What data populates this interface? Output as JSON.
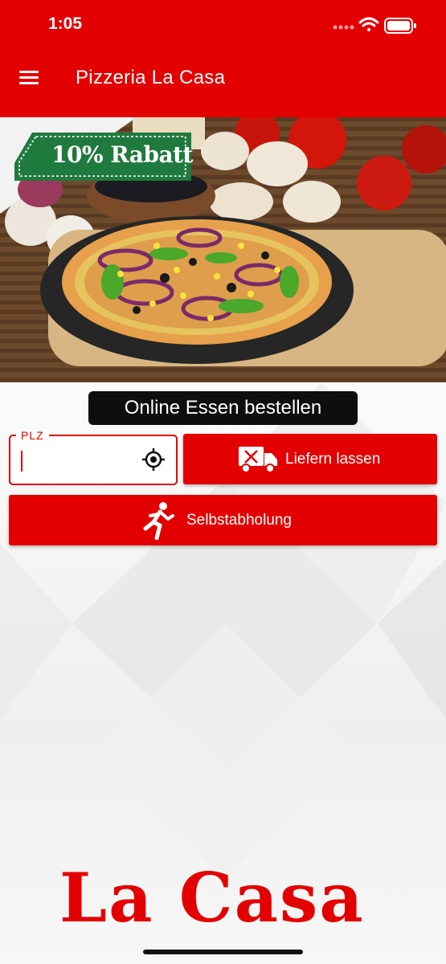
{
  "status_bar": {
    "time": "1:05"
  },
  "app_bar": {
    "title": "Pizzeria La Casa",
    "menu_icon": "hamburger-menu-icon",
    "accent_color": "#e30000"
  },
  "hero": {
    "badge_text": "10% Rabatt",
    "badge_color": "#1f7a3e"
  },
  "order": {
    "heading": "Online Essen bestellen",
    "plz_label": "PLZ",
    "plz_value": "",
    "locate_icon": "crosshair-locate-icon",
    "deliver_label": "Liefern lassen",
    "deliver_icon": "delivery-truck-icon",
    "pickup_label": "Selbstabholung",
    "pickup_icon": "running-person-icon"
  },
  "footer": {
    "logo_text": "La Casa"
  }
}
